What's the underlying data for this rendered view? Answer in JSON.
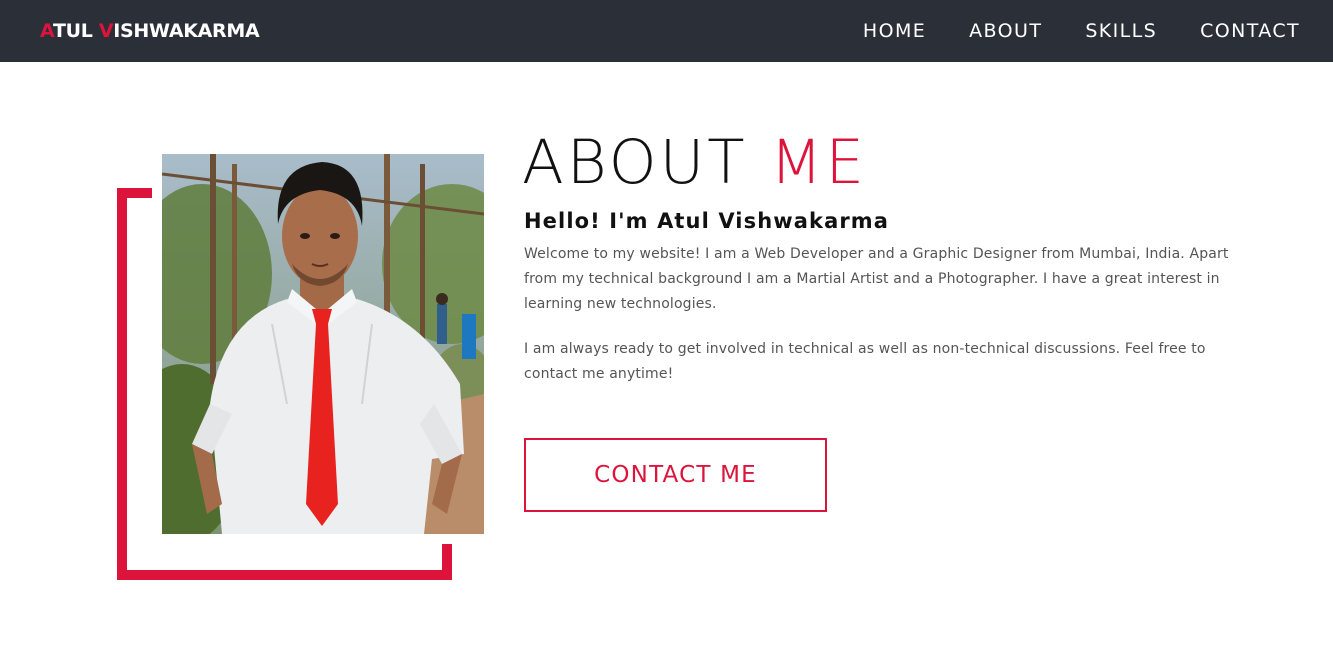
{
  "navbar": {
    "brand": {
      "first_initial": "A",
      "first_rest": "TUL ",
      "last_initial": "V",
      "last_rest": "ISHWAKARMA"
    },
    "links": [
      "HOME",
      "ABOUT",
      "SKILLS",
      "CONTACT"
    ]
  },
  "about": {
    "title_main": "ABOUT ",
    "title_accent": "ME",
    "greeting": "Hello! I'm Atul Vishwakarma",
    "paragraphs": [
      "Welcome to my website! I am a Web Developer and a Graphic Designer from Mumbai, India. Apart from my technical background I am a Martial Artist and a Photographer. I have a great interest in learning new technologies.",
      "I am always ready to get involved in technical as well as non-technical discussions. Feel free to contact me anytime!"
    ],
    "contact_button": "CONTACT ME"
  },
  "colors": {
    "accent": "#dc143c",
    "navbar_bg": "#2b3038"
  }
}
